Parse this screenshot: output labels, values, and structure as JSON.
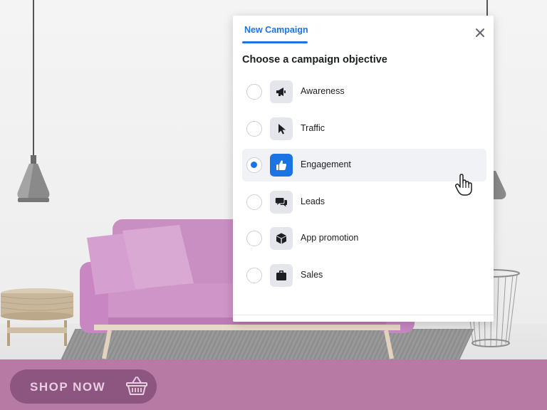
{
  "modal": {
    "tab_label": "New Campaign",
    "heading": "Choose a campaign objective",
    "options": [
      {
        "label": "Awareness",
        "icon": "megaphone-icon",
        "selected": false
      },
      {
        "label": "Traffic",
        "icon": "cursor-icon",
        "selected": false
      },
      {
        "label": "Engagement",
        "icon": "thumbs-up-icon",
        "selected": true
      },
      {
        "label": "Leads",
        "icon": "chat-bubbles-icon",
        "selected": false
      },
      {
        "label": "App promotion",
        "icon": "cube-icon",
        "selected": false
      },
      {
        "label": "Sales",
        "icon": "briefcase-icon",
        "selected": false
      }
    ]
  },
  "banner": {
    "button_label": "SHOP NOW",
    "button_icon": "basket-icon"
  },
  "colors": {
    "accent": "#1b74e4",
    "banner": "#b77aa5",
    "button": "#8c5680",
    "sofa": "#c887c2"
  }
}
